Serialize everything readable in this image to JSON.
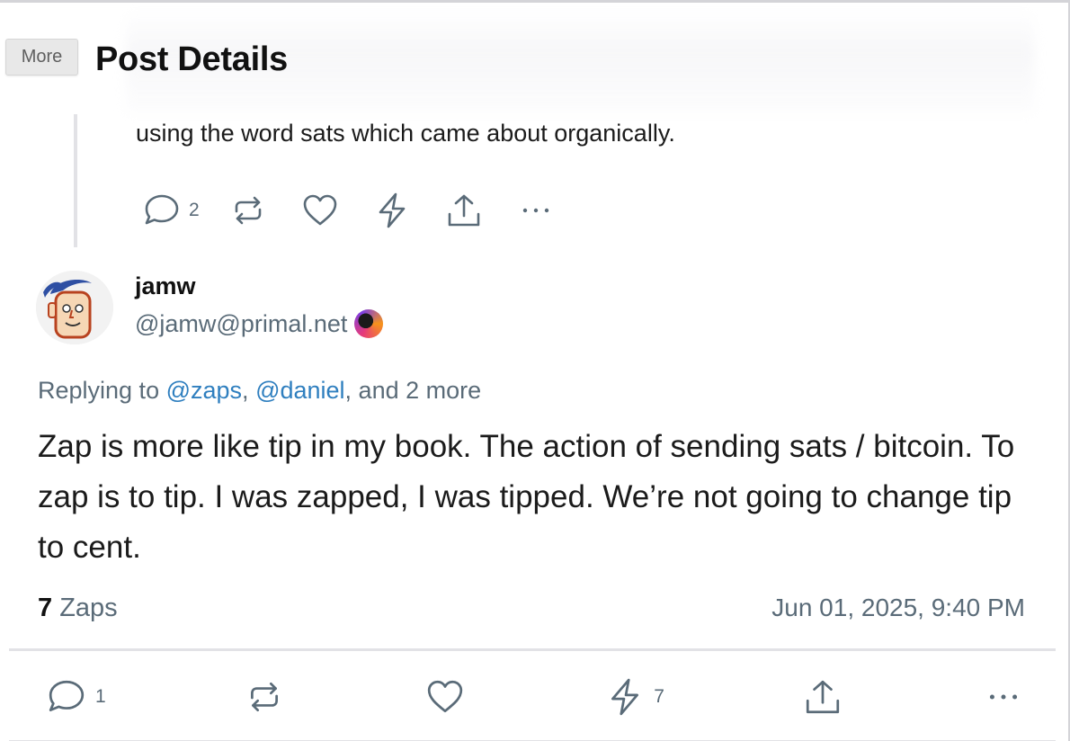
{
  "header": {
    "more_label": "More",
    "title": "Post Details"
  },
  "parent_post": {
    "text": "using the word sats which came about organically.",
    "actions": {
      "reply_count": "2"
    }
  },
  "post": {
    "author_name": "jamw",
    "author_handle": "@jamw@primal.net",
    "replying_prefix": "Replying to ",
    "mention_1": "@zaps",
    "separator": ", ",
    "mention_2": "@daniel",
    "replying_suffix": ", and 2 more",
    "body": "Zap is more like tip in my book. The action of sending sats / bitcoin. To zap is to tip. I was zapped, I was tipped. We’re not going to change tip to cent.",
    "zaps_count": "7",
    "zaps_label": " Zaps",
    "timestamp": "Jun 01, 2025, 9:40 PM",
    "actions": {
      "reply_count": "1",
      "zap_count": "7"
    }
  },
  "icons": {
    "reply": "reply-bubble-icon",
    "repost": "repost-icon",
    "like": "heart-icon",
    "zap": "lightning-icon",
    "share": "share-upload-icon",
    "more": "more-dots-icon",
    "verified": "primal-verified-badge-icon"
  },
  "colors": {
    "muted": "#5a6b78",
    "link": "#2f7fbf",
    "text": "#1b1b1b"
  }
}
